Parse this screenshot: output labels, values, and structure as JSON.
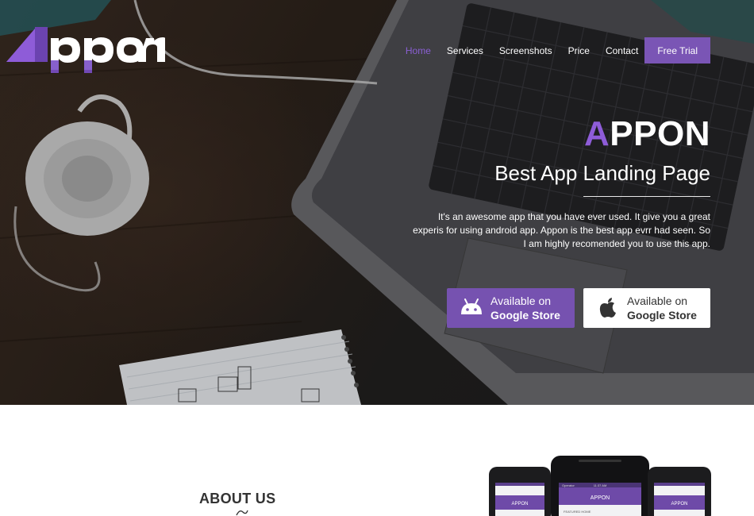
{
  "brand": {
    "logo_text": "Appon",
    "accent_color": "#7a55b5",
    "accent_text_color": "#8e5cd8"
  },
  "nav": {
    "items": [
      {
        "label": "Home",
        "active": true
      },
      {
        "label": "Services",
        "active": false
      },
      {
        "label": "Screenshots",
        "active": false
      },
      {
        "label": "Price",
        "active": false
      },
      {
        "label": "Contact",
        "active": false
      }
    ],
    "cta_label": "Free Trial"
  },
  "hero": {
    "title_first_letter": "A",
    "title_rest": "PPON",
    "subtitle": "Best App Landing Page",
    "description": "It's an awesome app that you have ever used. It give you a great experis for using android app. Appon is the best app evrr had seen. So I am highly recomended you to use this app."
  },
  "store_buttons": {
    "android": {
      "line1": "Available on",
      "line2": "Google Store",
      "icon": "android-icon"
    },
    "apple": {
      "line1": "Available on",
      "line2": "Google Store",
      "icon": "apple-icon"
    }
  },
  "about": {
    "title": "ABOUT US"
  },
  "phones": {
    "screen_brand": "APPON",
    "status_time": "11:37 AM",
    "status_operator": "Operator",
    "screen_caption": "FEATURED HOME"
  }
}
